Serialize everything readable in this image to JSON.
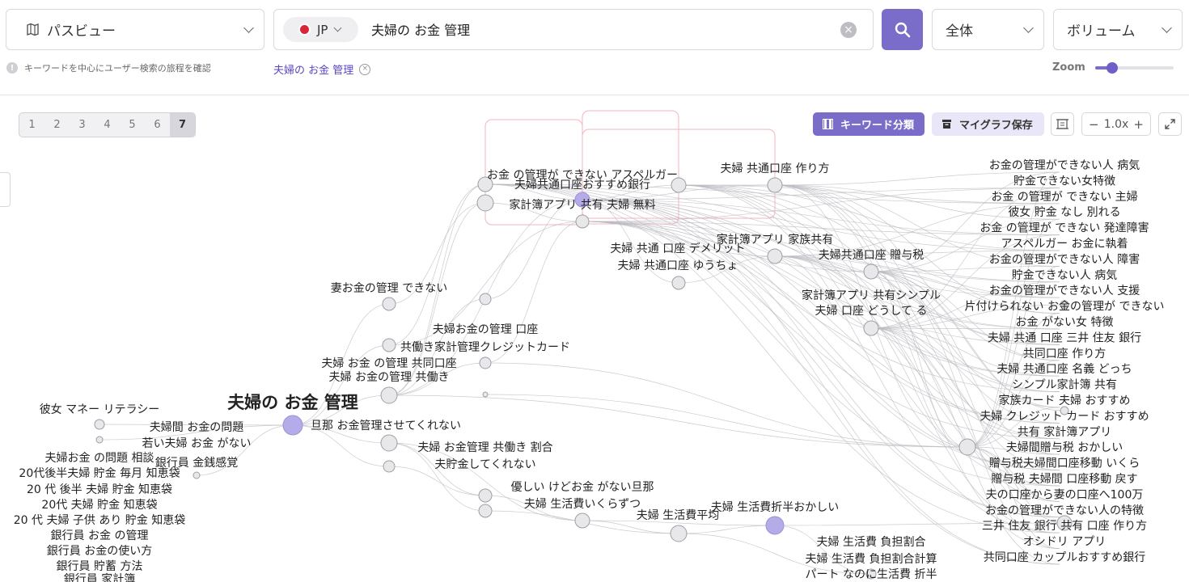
{
  "header": {
    "view_select": {
      "icon": "map-route-icon",
      "label": "パスビュー"
    },
    "country": {
      "flag_icon": "japan-flag-icon",
      "code": "JP"
    },
    "search": {
      "value": "夫婦の お金 管理"
    },
    "scope_select": "全体",
    "metric_select": "ボリューム",
    "hint": "キーワードを中心にユーザー検索の旅程を確認",
    "chip": "夫婦の お金 管理",
    "zoom_label": "Zoom",
    "zoom_level": 0.22
  },
  "toolbar": {
    "steps": [
      "1",
      "2",
      "3",
      "4",
      "5",
      "6",
      "7"
    ],
    "active_step": "7",
    "classify_label": "キーワード分類",
    "save_label": "マイグラフ保存",
    "zoom_value": "1.0x",
    "zoom_minus": "−",
    "zoom_plus": "+"
  },
  "colors": {
    "accent": "#7a6cc9",
    "accent_light": "#e9e6f7",
    "node": "#e8e8eb",
    "node_main": "#b4ace8"
  },
  "graph": {
    "center": "夫婦の お金 管理",
    "nodes": [
      "お金 の管理が できない アスペルガー",
      "夫婦共通口座おすすめ銀行",
      "家計簿アプリ 共有 夫婦 無料",
      "夫婦 共通口座 作り方",
      "家計簿アプリ 家族共有",
      "夫婦 共通 口座 デメリット",
      "夫婦 共通口座 ゆうちょ",
      "夫婦共通口座 贈与税",
      "家計簿アプリ 共有シンプル",
      "夫婦 口座 どうして る",
      "妻お金の管理 できない",
      "夫婦お金の管理 口座",
      "共働き家計管理クレジットカード",
      "夫婦 お金 の管理 共同口座",
      "夫婦 お金の管理 共働き",
      "旦那 お金管理させてくれない",
      "彼女 マネー リテラシー",
      "夫婦間 お金の問題",
      "若い夫婦 お金 がない",
      "夫婦お金 の問題 相談",
      "銀行員 金銭感覚",
      "20代後半夫婦 貯金 毎月 知恵袋",
      "20 代 後半 夫婦 貯金 知恵袋",
      "20代 夫婦 貯金 知恵袋",
      "20 代 夫婦 子供 あり 貯金 知恵袋",
      "銀行員 お金 の管理",
      "銀行員 お金の使い方",
      "銀行員 貯蓄 方法",
      "銀行員 家計簿",
      "夫婦 お金管理 共働き 割合",
      "夫貯金してくれない",
      "優しい けどお金 がない旦那",
      "夫婦 生活費いくらずつ",
      "夫婦 生活費平均",
      "夫婦 生活費折半おかしい",
      "夫婦 生活費 負担割合",
      "夫婦 生活費 負担割合計算",
      "パート なのに生活費 折半"
    ],
    "right_list": [
      "お金の管理ができない人 病気",
      "貯金できない女特徴",
      "お金 の管理が できない 主婦",
      "彼女 貯金 なし 別れる",
      "お金 の管理が できない 発達障害",
      "アスペルガー お金に執着",
      "お金の管理ができない人 障害",
      "貯金できない人 病気",
      "お金の管理ができない人 支援",
      "片付けられない お金の管理が できない",
      "お金 がない女 特徴",
      "夫婦 共通 口座 三井 住友 銀行",
      "共同口座 作り方",
      "夫婦 共通口座 名義 どっち",
      "シンプル家計簿 共有",
      "家族カード 夫婦 おすすめ",
      "夫婦 クレジット カード おすすめ",
      "共有 家計簿アプリ",
      "夫婦間贈与税 おかしい",
      "贈与税夫婦間口座移動 いくら",
      "贈与税 夫婦間 口座移動 戻す",
      "夫の口座から妻の口座へ100万",
      "お金の管理ができない人の特徴",
      "三井 住友 銀行 共有 口座 作り方",
      "オシドリ アプリ",
      "共同口座 カップルおすすめ銀行"
    ]
  }
}
